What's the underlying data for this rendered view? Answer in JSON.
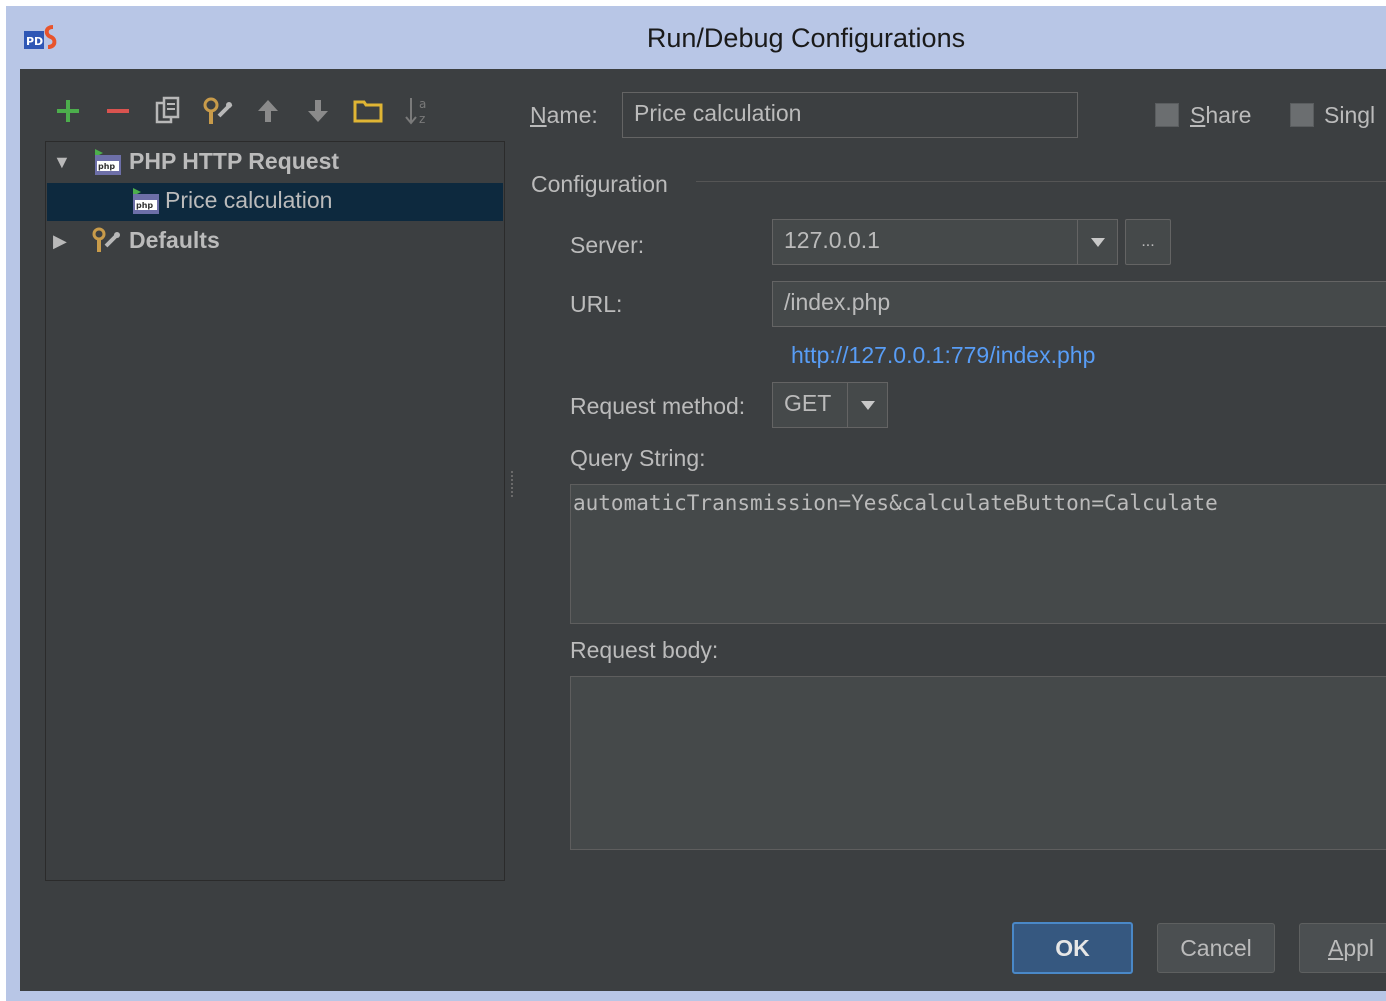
{
  "window": {
    "title": "Run/Debug Configurations"
  },
  "toolbar": {
    "icons": [
      "add-icon",
      "remove-icon",
      "copy-icon",
      "edit-defaults-icon",
      "move-up-icon",
      "move-down-icon",
      "folder-icon",
      "sort-icon"
    ]
  },
  "tree": {
    "items": [
      {
        "label": "PHP HTTP Request",
        "expanded": true,
        "icon": "php-http-request-icon"
      },
      {
        "label": "Price calculation",
        "selected": true,
        "icon": "php-http-request-icon"
      },
      {
        "label": "Defaults",
        "expanded": false,
        "icon": "defaults-wrench-icon"
      }
    ]
  },
  "form": {
    "name_label_mnemonic": "N",
    "name_label_rest": "ame:",
    "name_value": "Price calculation",
    "share_label_mnemonic": "S",
    "share_label_rest": "hare",
    "share_checked": false,
    "single_label": "Singl",
    "single_checked": false,
    "configuration_title": "Configuration",
    "server_label": "Server:",
    "server_value": "127.0.0.1",
    "server_more_label": "...",
    "url_label": "URL:",
    "url_value": "/index.php",
    "resolved_url": "http://127.0.0.1:779/index.php",
    "method_label": "Request method:",
    "method_value": "GET",
    "query_label": "Query String:",
    "query_value": "automaticTransmission=Yes&calculateButton=Calculate",
    "body_label": "Request body:",
    "body_value": ""
  },
  "buttons": {
    "ok": "OK",
    "cancel": "Cancel",
    "apply_mnemonic": "A",
    "apply_rest": "ppl"
  },
  "colors": {
    "title_bar": "#b8c6e6",
    "background": "#3c3f41",
    "selection": "#0d293e",
    "link": "#589df6",
    "add_icon": "#4cae4c",
    "remove_icon": "#d9534f"
  }
}
